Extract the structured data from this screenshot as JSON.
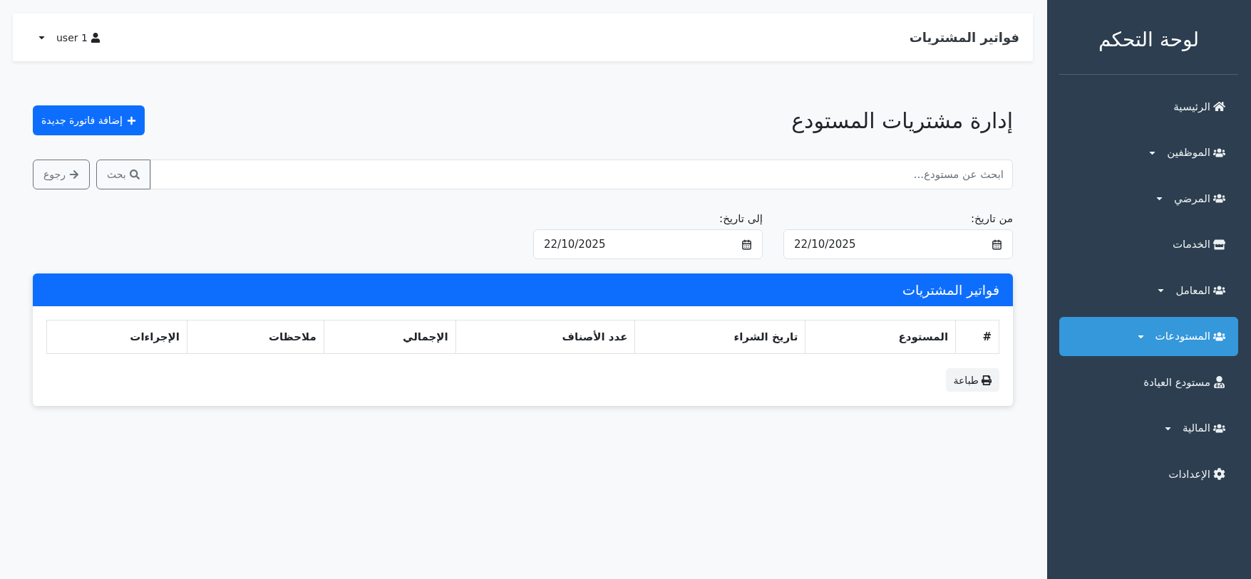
{
  "sidebar": {
    "title": "لوحة التحكم",
    "items": [
      {
        "label": "الرئيسية",
        "has_dropdown": false,
        "selected": false
      },
      {
        "label": "الموظفين",
        "has_dropdown": true,
        "selected": false
      },
      {
        "label": "المرضي",
        "has_dropdown": true,
        "selected": false
      },
      {
        "label": "الخدمات",
        "has_dropdown": false,
        "selected": false
      },
      {
        "label": "المعامل",
        "has_dropdown": true,
        "selected": false
      },
      {
        "label": "المستودعات",
        "has_dropdown": true,
        "selected": true
      },
      {
        "label": "مستودع العيادة",
        "has_dropdown": false,
        "selected": false
      },
      {
        "label": "المالية",
        "has_dropdown": true,
        "selected": false
      },
      {
        "label": "الإعدادات",
        "has_dropdown": false,
        "selected": false
      }
    ]
  },
  "top_bar": {
    "title": "فواتير المشتريات",
    "user": "user 1"
  },
  "page": {
    "heading": "إدارة مشتريات المستودع",
    "add_button": "إضافة فاتورة جديدة"
  },
  "search": {
    "placeholder": "ابحث عن مستودع...",
    "search_button": "بحث",
    "back_button": "رجوع"
  },
  "date_filters": [
    {
      "label": "من تاريخ:",
      "value": "22/10/2025"
    },
    {
      "label": "إلى تاريخ:",
      "value": "22/10/2025"
    }
  ],
  "card": {
    "title": "فواتير المشتريات",
    "table": {
      "columns": [
        "#",
        "المستودع",
        "تاريخ الشراء",
        "عدد الأصناف",
        "الإجمالي",
        "ملاحظات",
        "الإجراءات"
      ]
    },
    "print_button": "طباعة"
  }
}
